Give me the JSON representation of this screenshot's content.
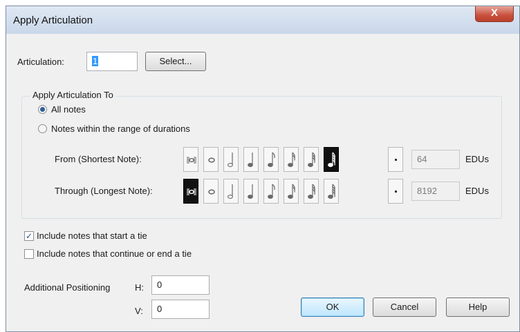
{
  "dialog": {
    "title": "Apply Articulation",
    "close_glyph": "X"
  },
  "articulation": {
    "label": "Articulation:",
    "value": "1",
    "select_label": "Select..."
  },
  "apply_to": {
    "group_title": "Apply Articulation To",
    "all_notes_label": "All notes",
    "all_notes_selected": true,
    "range_label": "Notes within the range of durations",
    "range_selected": false,
    "from_label": "From (Shortest Note):",
    "from_edus": "64",
    "from_selected_index": 7,
    "through_label": "Through (Longest Note):",
    "through_edus": "8192",
    "through_selected_index": 0,
    "edus_unit": "EDUs",
    "durations": [
      "breve-icon",
      "whole-note-icon",
      "half-note-icon",
      "quarter-note-icon",
      "eighth-note-icon",
      "sixteenth-note-icon",
      "thirty-second-note-icon",
      "sixty-fourth-note-icon"
    ]
  },
  "ties": {
    "start_label": "Include notes that start a tie",
    "start_checked": true,
    "continue_label": "Include notes that continue or end a tie",
    "continue_checked": false
  },
  "positioning": {
    "label": "Additional Positioning",
    "h_label": "H:",
    "h_value": "0",
    "v_label": "V:",
    "v_value": "0"
  },
  "buttons": {
    "ok": "OK",
    "cancel": "Cancel",
    "help": "Help"
  }
}
